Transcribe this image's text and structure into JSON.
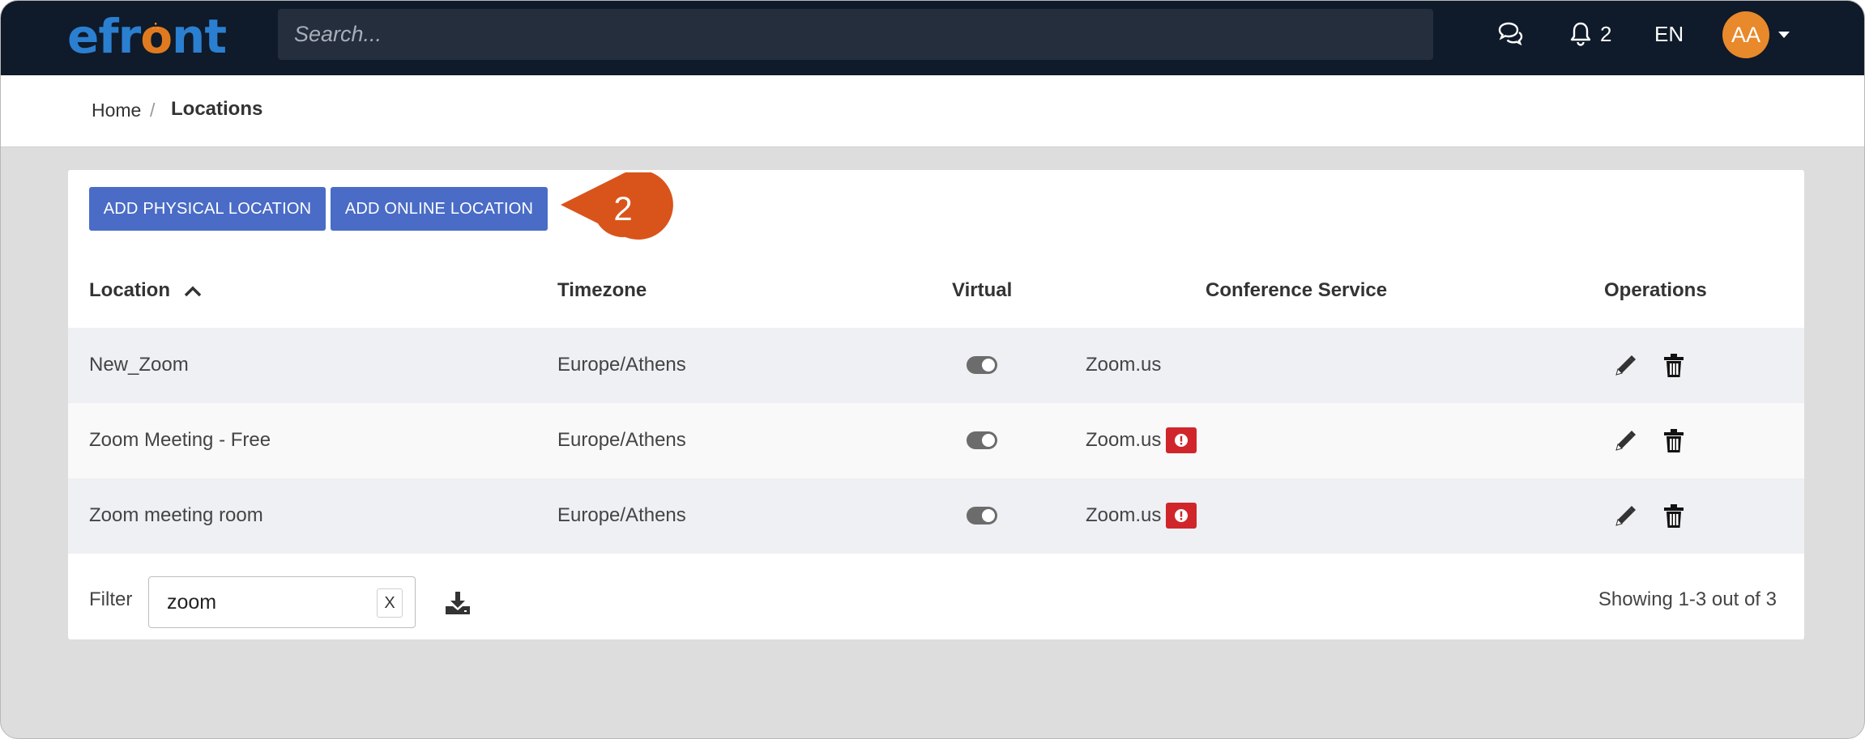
{
  "header": {
    "logo_text": "efront",
    "search_placeholder": "Search...",
    "notifications_count": "2",
    "language": "EN",
    "avatar_initials": "AA",
    "icons": [
      "chat-icon",
      "bell-icon",
      "caret-down-icon"
    ]
  },
  "breadcrumb": {
    "home": "Home",
    "separator": "/",
    "current": "Locations"
  },
  "toolbar": {
    "add_physical_label": "ADD PHYSICAL LOCATION",
    "add_online_label": "ADD ONLINE LOCATION",
    "callout_number": "2"
  },
  "table": {
    "columns": [
      "Location",
      "Timezone",
      "Virtual",
      "Conference Service",
      "Operations"
    ],
    "sort": {
      "column": "Location",
      "direction": "ascending"
    },
    "rows": [
      {
        "location": "New_Zoom",
        "timezone": "Europe/Athens",
        "virtual": true,
        "service": "Zoom.us",
        "warning": false
      },
      {
        "location": "Zoom Meeting - Free",
        "timezone": "Europe/Athens",
        "virtual": true,
        "service": "Zoom.us",
        "warning": true
      },
      {
        "location": "Zoom meeting room",
        "timezone": "Europe/Athens",
        "virtual": true,
        "service": "Zoom.us",
        "warning": true
      }
    ]
  },
  "footer": {
    "filter_label": "Filter",
    "filter_value": "zoom",
    "filter_clear": "X",
    "showing": "Showing 1-3 out of 3"
  },
  "colors": {
    "topbar": "#0f1a2a",
    "primary_button": "#4a6cc6",
    "callout": "#d9541a",
    "warning_badge": "#d0262b",
    "avatar": "#e8892b"
  }
}
